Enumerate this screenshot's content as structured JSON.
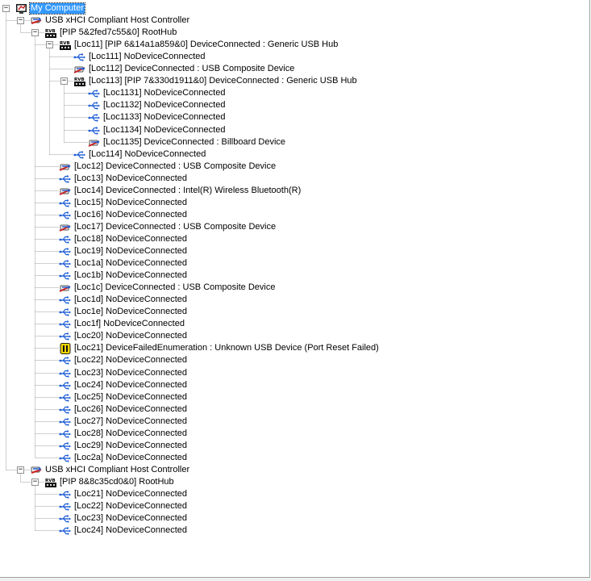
{
  "tree": [
    {
      "label": "My Computer",
      "icon": "computer-icon",
      "depth": 0,
      "expanded": true,
      "selected": true
    },
    {
      "label": "USB xHCI Compliant Host Controller",
      "icon": "usb-controller-icon",
      "depth": 1,
      "expanded": true
    },
    {
      "label": "[PIP 5&2fed7c55&0] RootHub",
      "icon": "hub-icon",
      "depth": 2,
      "expanded": true
    },
    {
      "label": "[Loc11] [PIP 6&14a1a859&0] DeviceConnected :  Generic USB Hub",
      "icon": "hub-icon",
      "depth": 3,
      "expanded": true
    },
    {
      "label": "[Loc111] NoDeviceConnected",
      "icon": "usb-port-icon",
      "depth": 4
    },
    {
      "label": "[Loc112] DeviceConnected :  USB Composite Device",
      "icon": "usb-device-icon",
      "depth": 4
    },
    {
      "label": "[Loc113] [PIP 7&330d1911&0] DeviceConnected :  Generic USB Hub",
      "icon": "hub-icon",
      "depth": 4,
      "expanded": true
    },
    {
      "label": "[Loc1131] NoDeviceConnected",
      "icon": "usb-port-icon",
      "depth": 5
    },
    {
      "label": "[Loc1132] NoDeviceConnected",
      "icon": "usb-port-icon",
      "depth": 5
    },
    {
      "label": "[Loc1133] NoDeviceConnected",
      "icon": "usb-port-icon",
      "depth": 5
    },
    {
      "label": "[Loc1134] NoDeviceConnected",
      "icon": "usb-port-icon",
      "depth": 5
    },
    {
      "label": "[Loc1135] DeviceConnected :  Billboard Device",
      "icon": "usb-device-icon",
      "depth": 5
    },
    {
      "label": "[Loc114] NoDeviceConnected",
      "icon": "usb-port-icon",
      "depth": 4
    },
    {
      "label": "[Loc12] DeviceConnected :  USB Composite Device",
      "icon": "usb-device-icon",
      "depth": 3
    },
    {
      "label": "[Loc13] NoDeviceConnected",
      "icon": "usb-port-icon",
      "depth": 3
    },
    {
      "label": "[Loc14] DeviceConnected :  Intel(R) Wireless Bluetooth(R)",
      "icon": "usb-device-icon",
      "depth": 3
    },
    {
      "label": "[Loc15] NoDeviceConnected",
      "icon": "usb-port-icon",
      "depth": 3
    },
    {
      "label": "[Loc16] NoDeviceConnected",
      "icon": "usb-port-icon",
      "depth": 3
    },
    {
      "label": "[Loc17] DeviceConnected :  USB Composite Device",
      "icon": "usb-device-icon",
      "depth": 3
    },
    {
      "label": "[Loc18] NoDeviceConnected",
      "icon": "usb-port-icon",
      "depth": 3
    },
    {
      "label": "[Loc19] NoDeviceConnected",
      "icon": "usb-port-icon",
      "depth": 3
    },
    {
      "label": "[Loc1a] NoDeviceConnected",
      "icon": "usb-port-icon",
      "depth": 3
    },
    {
      "label": "[Loc1b] NoDeviceConnected",
      "icon": "usb-port-icon",
      "depth": 3
    },
    {
      "label": "[Loc1c] DeviceConnected :  USB Composite Device",
      "icon": "usb-device-icon",
      "depth": 3
    },
    {
      "label": "[Loc1d] NoDeviceConnected",
      "icon": "usb-port-icon",
      "depth": 3
    },
    {
      "label": "[Loc1e] NoDeviceConnected",
      "icon": "usb-port-icon",
      "depth": 3
    },
    {
      "label": "[Loc1f] NoDeviceConnected",
      "icon": "usb-port-icon",
      "depth": 3
    },
    {
      "label": "[Loc20] NoDeviceConnected",
      "icon": "usb-port-icon",
      "depth": 3
    },
    {
      "label": "[Loc21] DeviceFailedEnumeration :  Unknown USB Device (Port Reset Failed)",
      "icon": "warning-device-icon",
      "depth": 3
    },
    {
      "label": "[Loc22] NoDeviceConnected",
      "icon": "usb-port-icon",
      "depth": 3
    },
    {
      "label": "[Loc23] NoDeviceConnected",
      "icon": "usb-port-icon",
      "depth": 3
    },
    {
      "label": "[Loc24] NoDeviceConnected",
      "icon": "usb-port-icon",
      "depth": 3
    },
    {
      "label": "[Loc25] NoDeviceConnected",
      "icon": "usb-port-icon",
      "depth": 3
    },
    {
      "label": "[Loc26] NoDeviceConnected",
      "icon": "usb-port-icon",
      "depth": 3
    },
    {
      "label": "[Loc27] NoDeviceConnected",
      "icon": "usb-port-icon",
      "depth": 3
    },
    {
      "label": "[Loc28] NoDeviceConnected",
      "icon": "usb-port-icon",
      "depth": 3
    },
    {
      "label": "[Loc29] NoDeviceConnected",
      "icon": "usb-port-icon",
      "depth": 3
    },
    {
      "label": "[Loc2a] NoDeviceConnected",
      "icon": "usb-port-icon",
      "depth": 3
    },
    {
      "label": "USB xHCI Compliant Host Controller",
      "icon": "usb-controller-icon",
      "depth": 1,
      "expanded": true
    },
    {
      "label": "[PIP 8&8c35cd0&0] RootHub",
      "icon": "hub-icon",
      "depth": 2,
      "expanded": true
    },
    {
      "label": "[Loc21] NoDeviceConnected",
      "icon": "usb-port-icon",
      "depth": 3
    },
    {
      "label": "[Loc22] NoDeviceConnected",
      "icon": "usb-port-icon",
      "depth": 3
    },
    {
      "label": "[Loc23] NoDeviceConnected",
      "icon": "usb-port-icon",
      "depth": 3
    },
    {
      "label": "[Loc24] NoDeviceConnected",
      "icon": "usb-port-icon",
      "depth": 3
    }
  ],
  "colors": {
    "selection": "#3399ff",
    "usb_blue": "#1f5fd6",
    "device_red": "#cc2222",
    "warning_yellow": "#f2d600"
  }
}
